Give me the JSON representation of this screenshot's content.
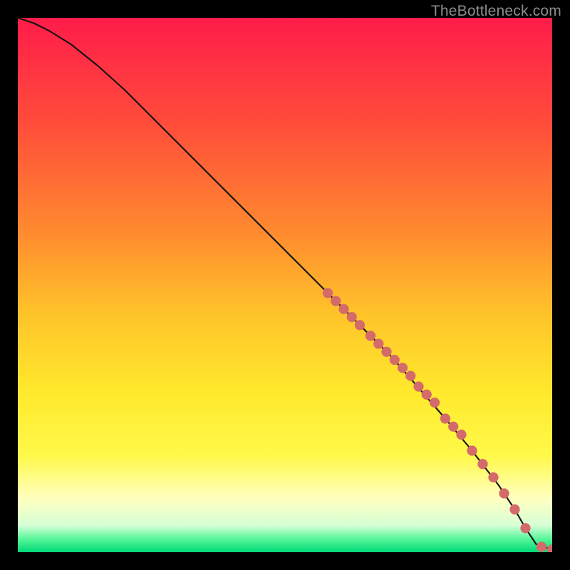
{
  "watermark": "TheBottleneck.com",
  "colors": {
    "bg": "#000000",
    "gradient_stops": [
      {
        "offset": 0.0,
        "color": "#ff1c4a"
      },
      {
        "offset": 0.2,
        "color": "#ff4d3a"
      },
      {
        "offset": 0.4,
        "color": "#ff8a2f"
      },
      {
        "offset": 0.55,
        "color": "#ffc22a"
      },
      {
        "offset": 0.7,
        "color": "#ffe92c"
      },
      {
        "offset": 0.82,
        "color": "#fff94a"
      },
      {
        "offset": 0.9,
        "color": "#ffffc0"
      },
      {
        "offset": 0.95,
        "color": "#d6ffd6"
      },
      {
        "offset": 0.975,
        "color": "#58f79a"
      },
      {
        "offset": 1.0,
        "color": "#00d977"
      }
    ],
    "marker": "#d46a6a",
    "line": "#141414"
  },
  "chart_data": {
    "type": "line",
    "title": "",
    "xlabel": "",
    "ylabel": "",
    "xlim": [
      0,
      100
    ],
    "ylim": [
      0,
      100
    ],
    "series": [
      {
        "name": "curve",
        "x": [
          0,
          3,
          6,
          10,
          15,
          20,
          30,
          40,
          50,
          60,
          70,
          80,
          85,
          90,
          93,
          95,
          97,
          100
        ],
        "y": [
          100,
          99,
          97.5,
          95,
          91,
          86.5,
          76.5,
          66.5,
          56.5,
          46.5,
          36.5,
          25,
          19,
          12.5,
          8,
          4.5,
          1.5,
          0.5
        ]
      }
    ],
    "markers": {
      "name": "points",
      "x": [
        58,
        59.5,
        61,
        62.5,
        64,
        66,
        67.5,
        69,
        70.5,
        72,
        73.5,
        75,
        76.5,
        78,
        80,
        81.5,
        83,
        85,
        87,
        89,
        91,
        93,
        95,
        98,
        100
      ],
      "y": [
        48.5,
        47,
        45.5,
        44,
        42.5,
        40.5,
        39,
        37.5,
        36,
        34.5,
        33,
        31,
        29.5,
        28,
        25,
        23.5,
        22,
        19,
        16.5,
        14,
        11,
        8,
        4.5,
        1,
        0.5
      ]
    }
  }
}
